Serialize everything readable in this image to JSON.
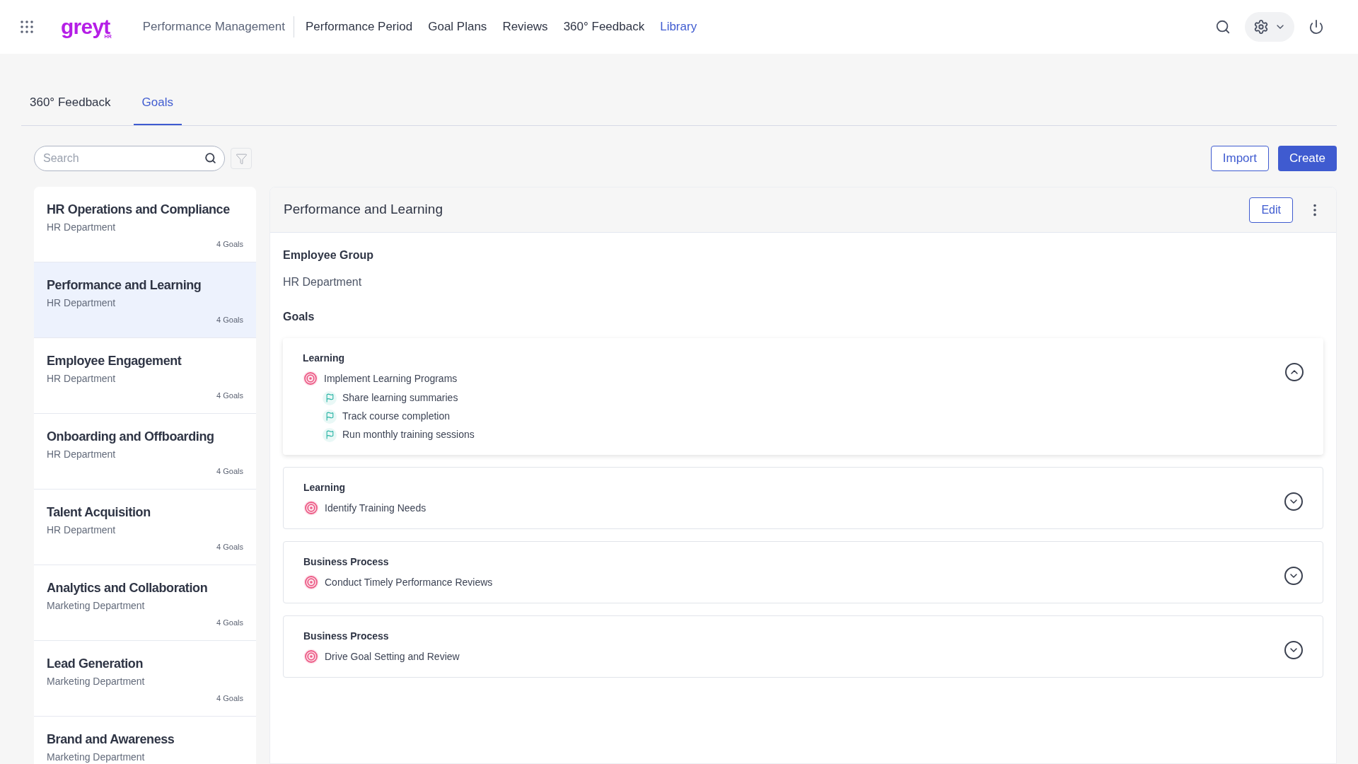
{
  "header": {
    "logo": {
      "text": "greyt",
      "sub": "HR"
    },
    "module": "Performance Management",
    "nav": [
      {
        "label": "Performance Period",
        "selected": false
      },
      {
        "label": "Goal Plans",
        "selected": false
      },
      {
        "label": "Reviews",
        "selected": false
      },
      {
        "label": "360° Feedback",
        "selected": false
      },
      {
        "label": "Library",
        "selected": true
      }
    ]
  },
  "tabs": [
    {
      "label": "360° Feedback",
      "selected": false
    },
    {
      "label": "Goals",
      "selected": true
    }
  ],
  "search": {
    "placeholder": "Search"
  },
  "buttons": {
    "import": "Import",
    "create": "Create"
  },
  "plans": [
    {
      "title": "HR Operations and Compliance",
      "department": "HR Department",
      "count": "4 Goals",
      "selected": false
    },
    {
      "title": "Performance and Learning",
      "department": "HR Department",
      "count": "4 Goals",
      "selected": true
    },
    {
      "title": "Employee Engagement",
      "department": "HR Department",
      "count": "4 Goals",
      "selected": false
    },
    {
      "title": "Onboarding and Offboarding",
      "department": "HR Department",
      "count": "4 Goals",
      "selected": false
    },
    {
      "title": "Talent Acquisition",
      "department": "HR Department",
      "count": "4 Goals",
      "selected": false
    },
    {
      "title": "Analytics and Collaboration",
      "department": "Marketing Department",
      "count": "4 Goals",
      "selected": false
    },
    {
      "title": "Lead Generation",
      "department": "Marketing Department",
      "count": "4 Goals",
      "selected": false
    },
    {
      "title": "Brand and Awareness",
      "department": "Marketing Department",
      "selected": false
    }
  ],
  "detail": {
    "title": "Performance and Learning",
    "edit": "Edit",
    "group_label": "Employee Group",
    "group": "HR Department",
    "goals_label": "Goals",
    "goals": [
      {
        "category": "Learning",
        "name": "Implement Learning Programs",
        "expanded": true,
        "children": [
          {
            "name": "Share learning summaries"
          },
          {
            "name": "Track course completion"
          },
          {
            "name": "Run monthly training sessions"
          }
        ]
      },
      {
        "category": "Learning",
        "name": "Identify Training Needs",
        "expanded": false
      },
      {
        "category": "Business Process",
        "name": "Conduct Timely Performance Reviews",
        "expanded": false
      },
      {
        "category": "Business Process",
        "name": "Drive Goal Setting and Review",
        "expanded": false
      }
    ]
  }
}
